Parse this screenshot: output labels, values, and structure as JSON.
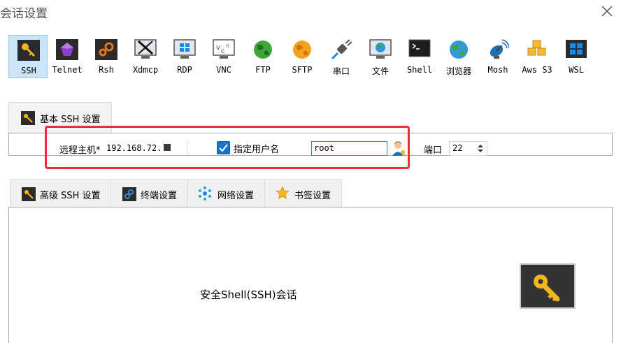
{
  "window": {
    "title": "会话设置"
  },
  "protocols": [
    {
      "label": "SSH",
      "icon": "key-icon",
      "selected": true
    },
    {
      "label": "Telnet",
      "icon": "gem-icon"
    },
    {
      "label": "Rsh",
      "icon": "gears-icon"
    },
    {
      "label": "Xdmcp",
      "icon": "x-display-icon"
    },
    {
      "label": "RDP",
      "icon": "windows-monitor-icon"
    },
    {
      "label": "VNC",
      "icon": "vnc-icon"
    },
    {
      "label": "FTP",
      "icon": "globe-green-icon"
    },
    {
      "label": "SFTP",
      "icon": "globe-orange-icon"
    },
    {
      "label": "串口",
      "icon": "plug-icon"
    },
    {
      "label": "文件",
      "icon": "file-monitor-icon"
    },
    {
      "label": "Shell",
      "icon": "terminal-icon"
    },
    {
      "label": "浏览器",
      "icon": "browser-globe-icon"
    },
    {
      "label": "Mosh",
      "icon": "satellite-icon"
    },
    {
      "label": "Aws S3",
      "icon": "cubes-icon"
    },
    {
      "label": "WSL",
      "icon": "windows-logo-icon"
    }
  ],
  "basic_tab": {
    "label": "基本 SSH 设置"
  },
  "fields": {
    "remote_host_label": "远程主机",
    "required_mark": "*",
    "remote_host_value": "192.168.72.",
    "specify_username_label": "指定用户名",
    "specify_username_checked": true,
    "username_value": "root",
    "port_label": "端口",
    "port_value": "22"
  },
  "sub_tabs": [
    {
      "label": "高级 SSH 设置",
      "icon": "key-icon"
    },
    {
      "label": "终端设置",
      "icon": "gears-icon"
    },
    {
      "label": "网络设置",
      "icon": "network-icon"
    },
    {
      "label": "书签设置",
      "icon": "star-icon"
    }
  ],
  "content": {
    "description": "安全Shell(SSH)会话",
    "icon": "key-icon"
  },
  "colors": {
    "accent": "#1a73c8",
    "highlight": "#e8303a",
    "selected_bg": "#cce4f7"
  }
}
